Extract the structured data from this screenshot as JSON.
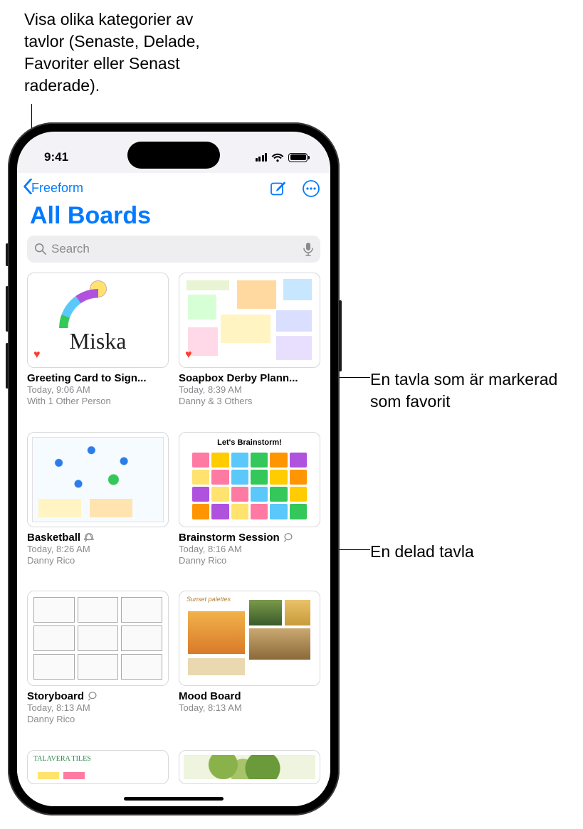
{
  "callouts": {
    "top": "Visa olika kategorier av tavlor (Senaste, Delade, Favoriter eller Senast raderade).",
    "favorite": "En tavla som är markerad som favorit",
    "shared": "En delad tavla"
  },
  "status": {
    "time": "9:41"
  },
  "nav": {
    "back_label": "Freeform"
  },
  "header": {
    "title": "All Boards"
  },
  "search": {
    "placeholder": "Search"
  },
  "boards": [
    {
      "title": "Greeting Card to Sign...",
      "time": "Today, 9:06 AM",
      "people": "With 1 Other Person",
      "favorite": true,
      "shared": false
    },
    {
      "title": "Soapbox Derby Plann...",
      "time": "Today, 8:39 AM",
      "people": "Danny & 3 Others",
      "favorite": true,
      "shared": false
    },
    {
      "title": "Basketball",
      "time": "Today, 8:26 AM",
      "people": "Danny Rico",
      "favorite": false,
      "shared": true
    },
    {
      "title": "Brainstorm Session",
      "time": "Today, 8:16 AM",
      "people": "Danny Rico",
      "favorite": false,
      "shared": true
    },
    {
      "title": "Storyboard",
      "time": "Today, 8:13 AM",
      "people": "Danny Rico",
      "favorite": false,
      "shared": true
    },
    {
      "title": "Mood Board",
      "time": "Today, 8:13 AM",
      "people": "",
      "favorite": false,
      "shared": false
    }
  ],
  "thumb_text": {
    "miska": "Miska",
    "brainstorm": "Let's Brainstorm!",
    "mood": "Sunset palettes",
    "tiles": "TALAVERA TILES"
  },
  "note_colors": [
    "#ff7aa2",
    "#ffcc00",
    "#5ac8fa",
    "#34c759",
    "#ff9500",
    "#af52de",
    "#ffe36e",
    "#ff7aa2",
    "#5ac8fa",
    "#34c759",
    "#ffcc00",
    "#ff9500",
    "#af52de",
    "#ffe36e",
    "#ff7aa2",
    "#5ac8fa",
    "#34c759",
    "#ffcc00",
    "#ff9500",
    "#af52de",
    "#ffe36e",
    "#ff7aa2",
    "#5ac8fa",
    "#34c759"
  ]
}
